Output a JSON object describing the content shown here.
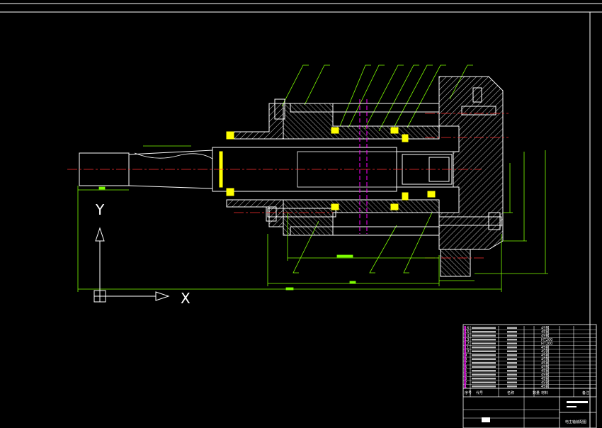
{
  "axes": {
    "y_label": "Y",
    "x_label": "X"
  },
  "title_block": {
    "drawing_name": "电主轴装配图",
    "headers": [
      "序号",
      "代号",
      "名称",
      "数量",
      "材料",
      "备注"
    ],
    "parts": [
      {
        "no": "16",
        "material": "45钢"
      },
      {
        "no": "15",
        "material": "45钢"
      },
      {
        "no": "14",
        "material": "45钢"
      },
      {
        "no": "13",
        "material": "HT200"
      },
      {
        "no": "12",
        "material": "HT200"
      },
      {
        "no": "11",
        "material": "45钢"
      },
      {
        "no": "10",
        "material": "45钢"
      },
      {
        "no": "9",
        "material": "45钢"
      },
      {
        "no": "8",
        "material": "45钢"
      },
      {
        "no": "7",
        "material": "45钢"
      },
      {
        "no": "6",
        "material": "45钢"
      },
      {
        "no": "5",
        "material": "45钢"
      },
      {
        "no": "4",
        "material": "45钢"
      },
      {
        "no": "3",
        "material": "45钢"
      },
      {
        "no": "2",
        "material": "45钢"
      },
      {
        "no": "1",
        "material": "45钢"
      }
    ]
  },
  "colors": {
    "background": "#000000",
    "outline": "#ffffff",
    "dimension": "#7fff00",
    "centerline": "#ff3030",
    "section_hatch": "#ffffff",
    "bearing": "#ffff00",
    "seal": "#ff00ff"
  }
}
